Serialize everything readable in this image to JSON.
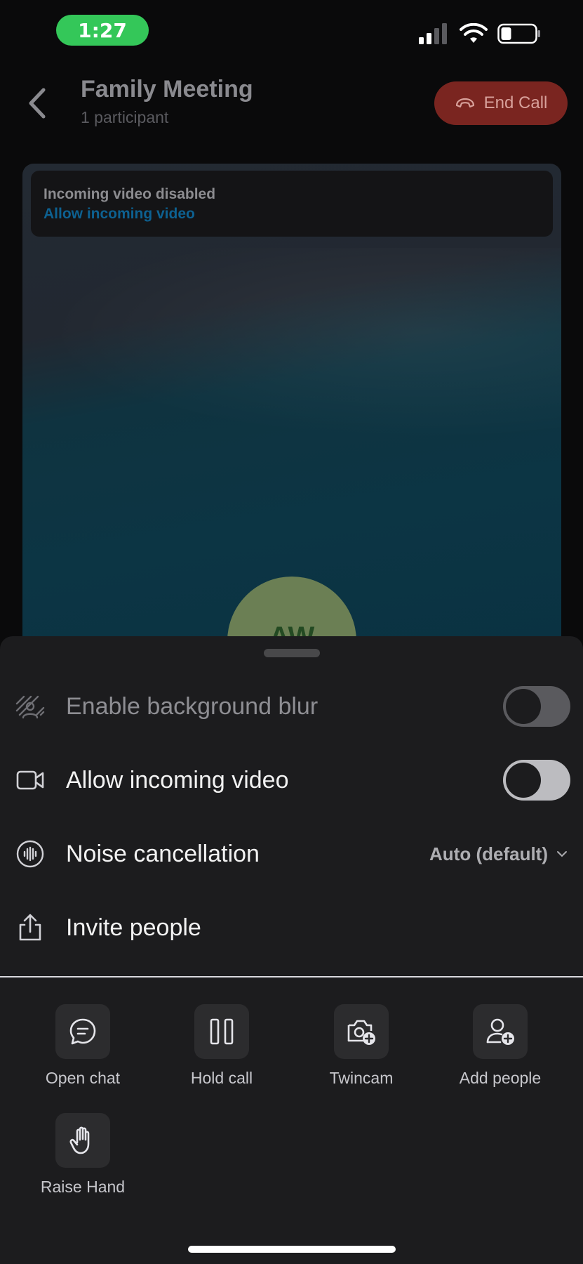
{
  "status_bar": {
    "time": "1:27",
    "battery_level": 0.3
  },
  "header": {
    "title": "Family Meeting",
    "subtitle": "1 participant",
    "end_call_label": "End Call"
  },
  "video": {
    "notice_title": "Incoming video disabled",
    "notice_link": "Allow incoming video",
    "avatar_initials": "AW"
  },
  "settings": [
    {
      "label": "Enable background blur",
      "control": "toggle",
      "on": false,
      "enabled": false,
      "icon": "blur-icon"
    },
    {
      "label": "Allow incoming video",
      "control": "toggle",
      "on": false,
      "enabled": true,
      "icon": "video-camera-icon"
    },
    {
      "label": "Noise cancellation",
      "control": "dropdown",
      "value": "Auto (default)",
      "icon": "waveform-icon"
    },
    {
      "label": "Invite people",
      "control": "none",
      "icon": "share-icon"
    }
  ],
  "actions": [
    {
      "label": "Open chat",
      "icon": "chat-bubble-icon"
    },
    {
      "label": "Hold call",
      "icon": "pause-icon"
    },
    {
      "label": "Twincam",
      "icon": "camera-plus-icon"
    },
    {
      "label": "Add people",
      "icon": "person-add-icon"
    },
    {
      "label": "Raise Hand",
      "icon": "hand-icon"
    }
  ],
  "colors": {
    "accent_link": "#0d6191",
    "end_call": "#7a2520",
    "time_pill": "#34c759",
    "sheet_bg": "#1c1c1e"
  }
}
